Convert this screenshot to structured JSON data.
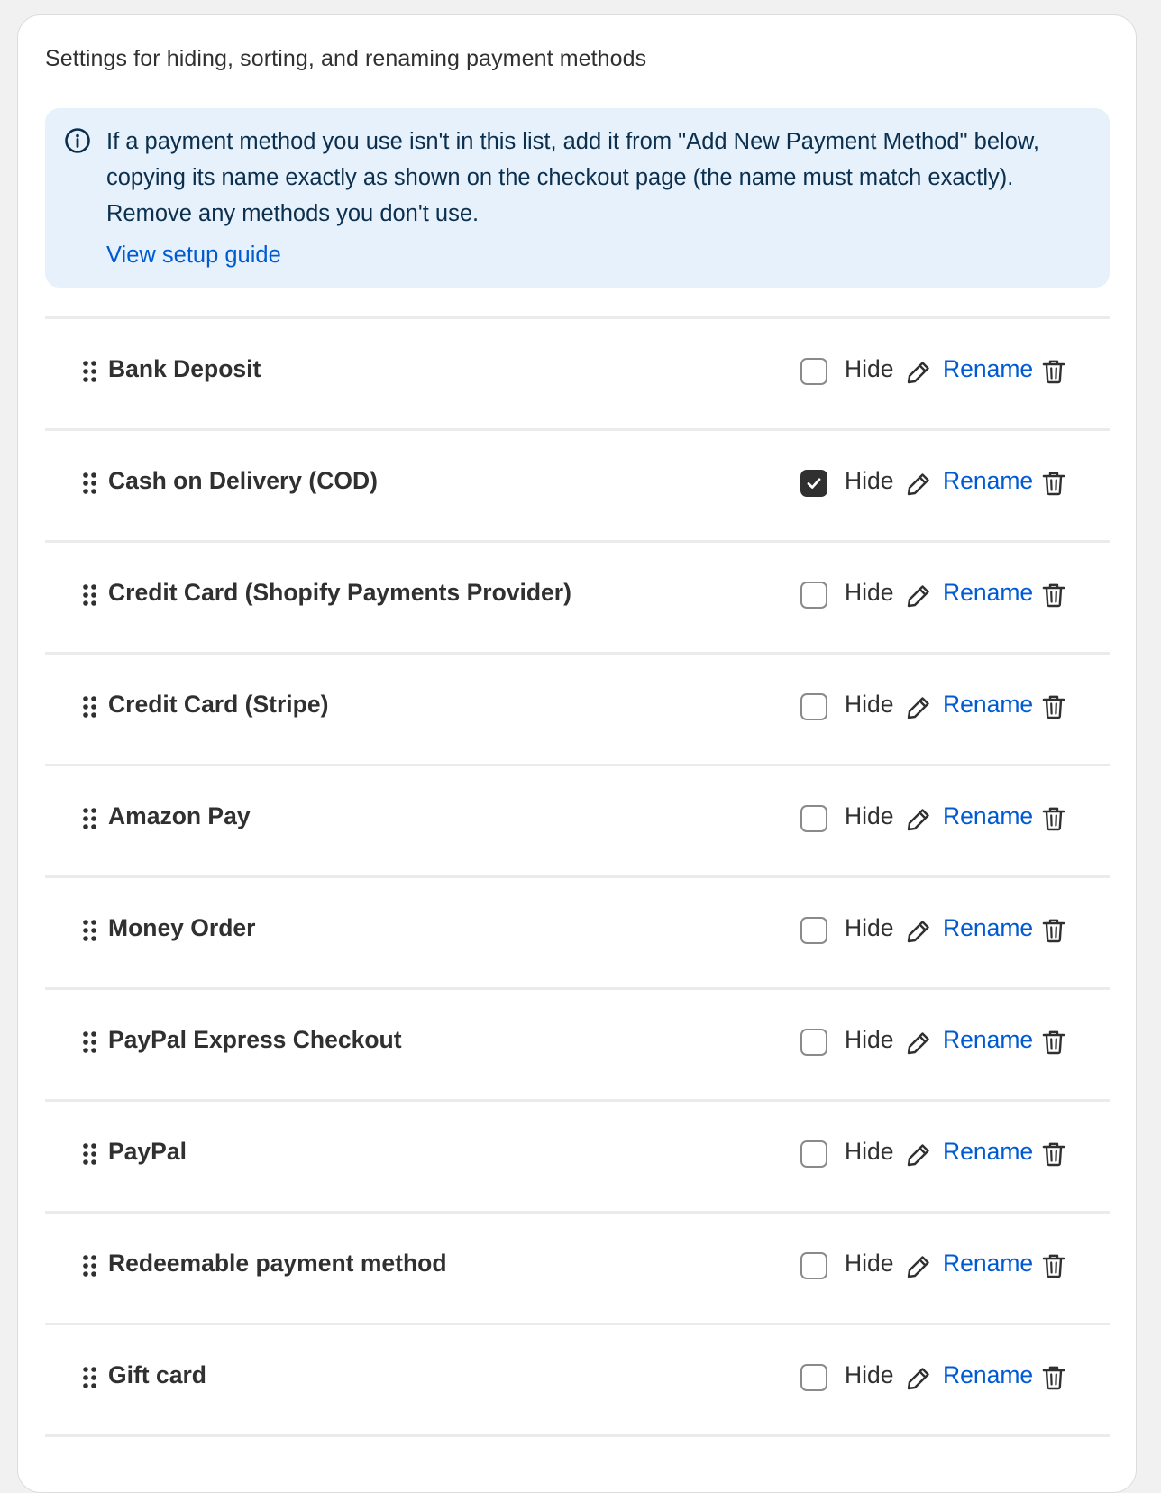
{
  "card": {
    "title": "Settings for hiding, sorting, and renaming payment methods"
  },
  "banner": {
    "icon": "info-icon",
    "text": "If a payment method you use isn't in this list, add it from \"Add New Payment Method\" below, copying its name exactly as shown on the checkout page (the name must match exactly). Remove any methods you don't use.",
    "link_label": "View setup guide"
  },
  "actions": {
    "hide_label": "Hide",
    "rename_label": "Rename",
    "drag_icon": "drag-handle-icon",
    "edit_icon": "pencil-icon",
    "delete_icon": "trash-icon"
  },
  "colors": {
    "link": "#005bd3",
    "banner_bg": "#e6f1fb",
    "text": "#303030",
    "checkbox_checked": "#303030"
  },
  "payment_methods": [
    {
      "name": "Bank Deposit",
      "hidden": false
    },
    {
      "name": "Cash on Delivery (COD)",
      "hidden": true
    },
    {
      "name": "Credit Card (Shopify Payments Provider)",
      "hidden": false
    },
    {
      "name": "Credit Card (Stripe)",
      "hidden": false
    },
    {
      "name": "Amazon Pay",
      "hidden": false
    },
    {
      "name": "Money Order",
      "hidden": false
    },
    {
      "name": "PayPal Express Checkout",
      "hidden": false
    },
    {
      "name": "PayPal",
      "hidden": false
    },
    {
      "name": "Redeemable payment method",
      "hidden": false
    },
    {
      "name": "Gift card",
      "hidden": false
    }
  ]
}
